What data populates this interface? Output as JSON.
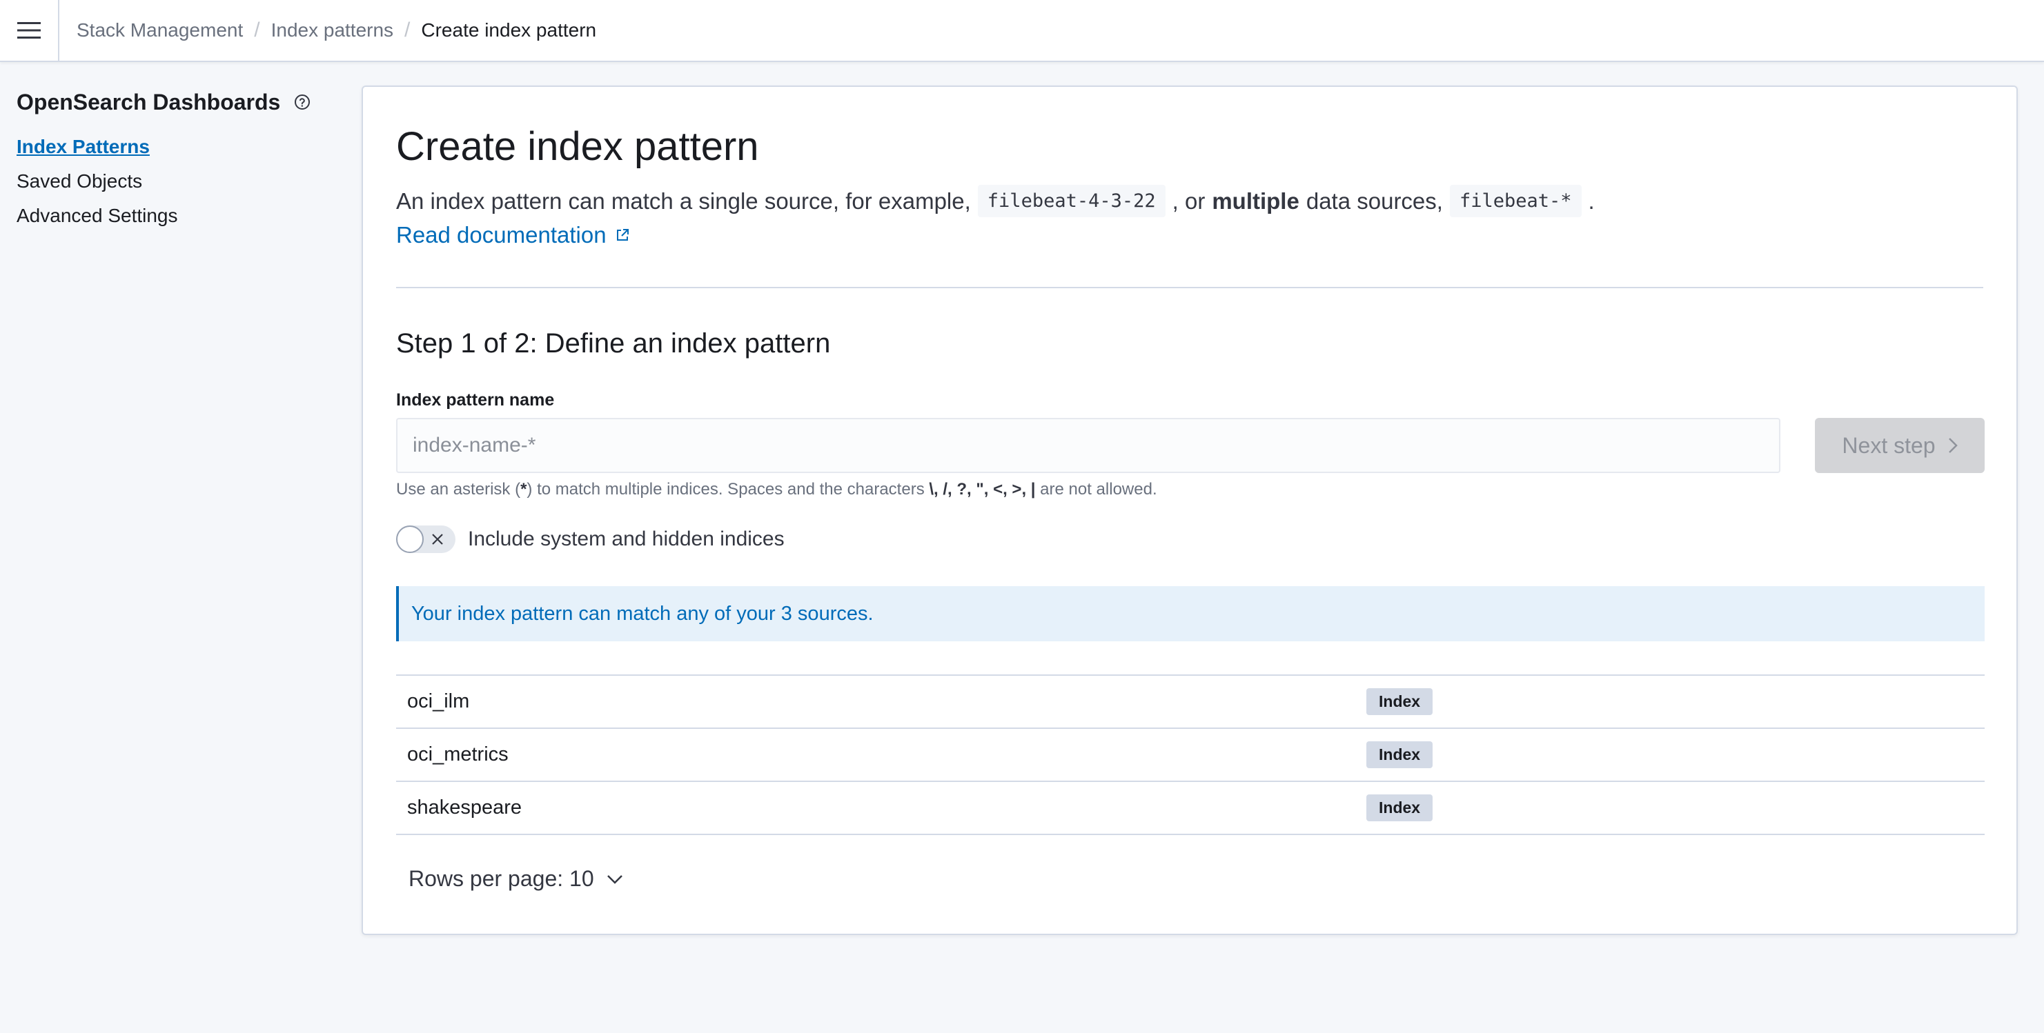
{
  "header": {
    "menu_icon": "hamburger-menu-icon",
    "breadcrumbs": [
      "Stack Management",
      "Index patterns",
      "Create index pattern"
    ],
    "separator": "/"
  },
  "sidebar": {
    "title": "OpenSearch Dashboards",
    "help_icon": "question-circle-icon",
    "items": [
      {
        "label": "Index Patterns",
        "active": true
      },
      {
        "label": "Saved Objects",
        "active": false
      },
      {
        "label": "Advanced Settings",
        "active": false
      }
    ]
  },
  "main": {
    "title": "Create index pattern",
    "description": {
      "part1": "An index pattern can match a single source, for example,",
      "code1": "filebeat-4-3-22",
      "part2": ", or",
      "bold": "multiple",
      "part3": "data sources,",
      "code2": "filebeat-*",
      "part4": "."
    },
    "doc_link": "Read documentation",
    "doc_link_icon": "external-link-icon",
    "step_title": "Step 1 of 2: Define an index pattern",
    "field_label": "Index pattern name",
    "input": {
      "value": "",
      "placeholder": "index-name-*"
    },
    "next_button": "Next step",
    "next_button_icon": "chevron-right-icon",
    "help_text": {
      "part1": "Use an asterisk (",
      "asterisk": "*",
      "part2": ") to match multiple indices. Spaces and the characters",
      "chars": "\\, /, ?, \", <, >, |",
      "part3": "are not allowed."
    },
    "toggle": {
      "label": "Include system and hidden indices",
      "checked": false,
      "icon": "cross-icon"
    },
    "callout": "Your index pattern can match any of your 3 sources.",
    "table": {
      "rows": [
        {
          "name": "oci_ilm",
          "badge": "Index"
        },
        {
          "name": "oci_metrics",
          "badge": "Index"
        },
        {
          "name": "shakespeare",
          "badge": "Index"
        }
      ]
    },
    "rows_per_page": "Rows per page: 10",
    "rows_per_page_icon": "chevron-down-icon"
  },
  "colors": {
    "primary": "#006bb8",
    "border": "#d3dae6",
    "page_background": "#f5f7fa",
    "callout_background": "#e6f1fa",
    "disabled_button": "#d3d4d7"
  }
}
